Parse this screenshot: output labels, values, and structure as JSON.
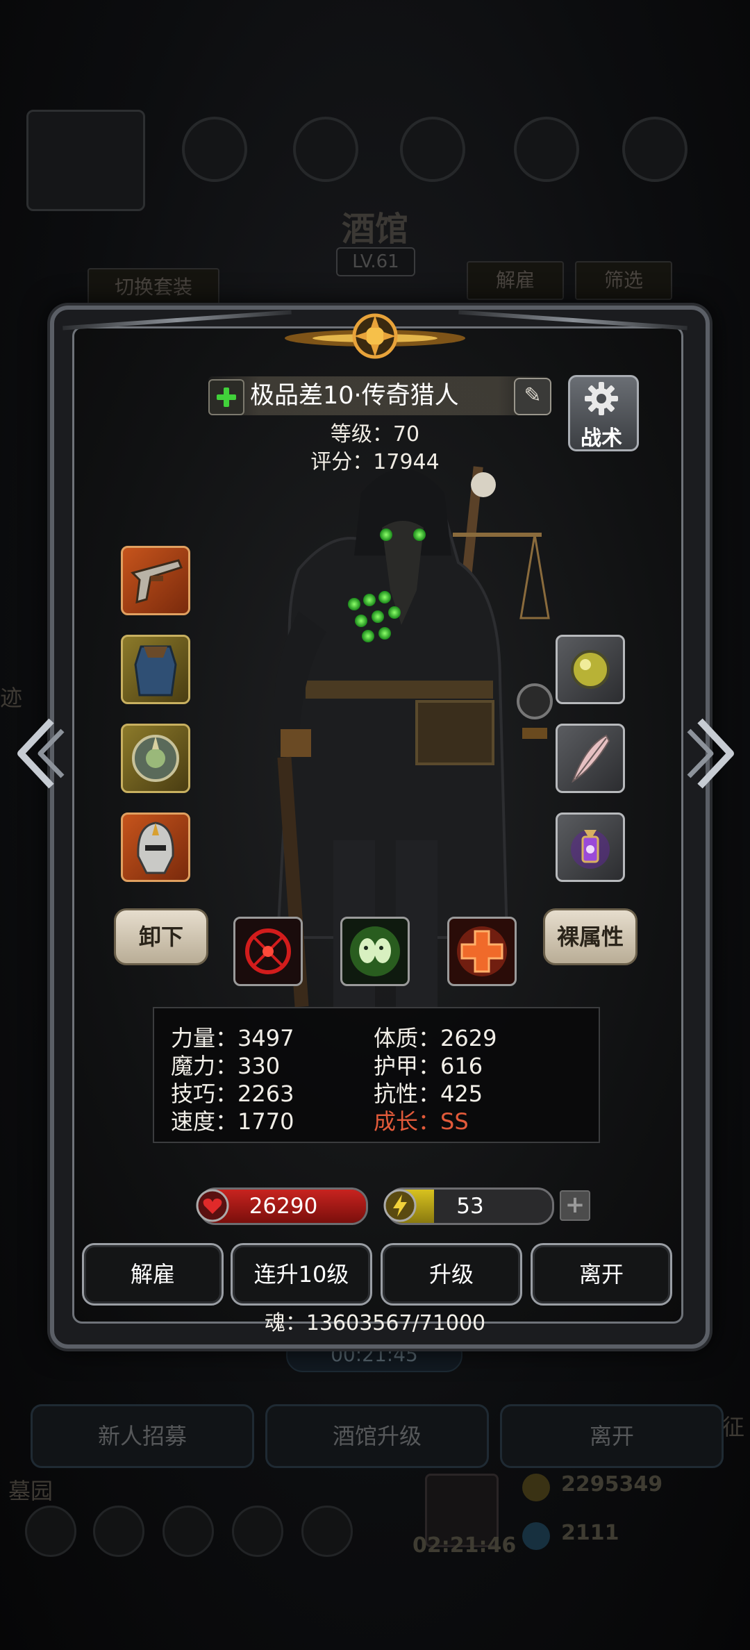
{
  "background": {
    "title": "酒馆",
    "level": "LV.61",
    "switch_outfit": "切换套装",
    "dismiss": "解雇",
    "filter": "筛选",
    "left_word": "迹",
    "right_word": "征",
    "bottom_left_word": "墓园",
    "timer_top": "00:21:45",
    "timer_bottom": "02:21:46",
    "gold": "2295349",
    "gems": "2111",
    "buttons": [
      "新人招募",
      "酒馆升级",
      "离开"
    ]
  },
  "hero": {
    "name": "极品差10·传奇猎人",
    "level_text": "等级：70",
    "score_text": "评分：17944",
    "tactics_label": "战术"
  },
  "equipment_left": [
    {
      "name": "pistol-item",
      "rarity": "orange"
    },
    {
      "name": "cloak-item",
      "rarity": "gold"
    },
    {
      "name": "amulet-item",
      "rarity": "gold"
    },
    {
      "name": "helmet-item",
      "rarity": "orange"
    }
  ],
  "equipment_right": [
    {
      "name": "orb-item",
      "rarity": "gray"
    },
    {
      "name": "feather-item",
      "rarity": "gray"
    },
    {
      "name": "lantern-item",
      "rarity": "gray"
    }
  ],
  "actions": {
    "unequip": "卸下",
    "naked_attributes": "裸属性"
  },
  "stats": [
    {
      "label": "力量：3497",
      "red": false
    },
    {
      "label": "体质：2629",
      "red": false
    },
    {
      "label": "魔力：330",
      "red": false
    },
    {
      "label": "护甲：616",
      "red": false
    },
    {
      "label": "技巧：2263",
      "red": false
    },
    {
      "label": "抗性：425",
      "red": false
    },
    {
      "label": "速度：1770",
      "red": false
    },
    {
      "label": "成长：SS",
      "red": true
    }
  ],
  "hp": {
    "value": "26290",
    "fill": 1.0,
    "color": "#c8231f"
  },
  "energy": {
    "value": "53",
    "fill": 0.28,
    "color": "#d8c21f"
  },
  "add_label": "+",
  "bottom_buttons": [
    "解雇",
    "连升10级",
    "升级",
    "离开"
  ],
  "soul_text": "魂：13603567/71000"
}
